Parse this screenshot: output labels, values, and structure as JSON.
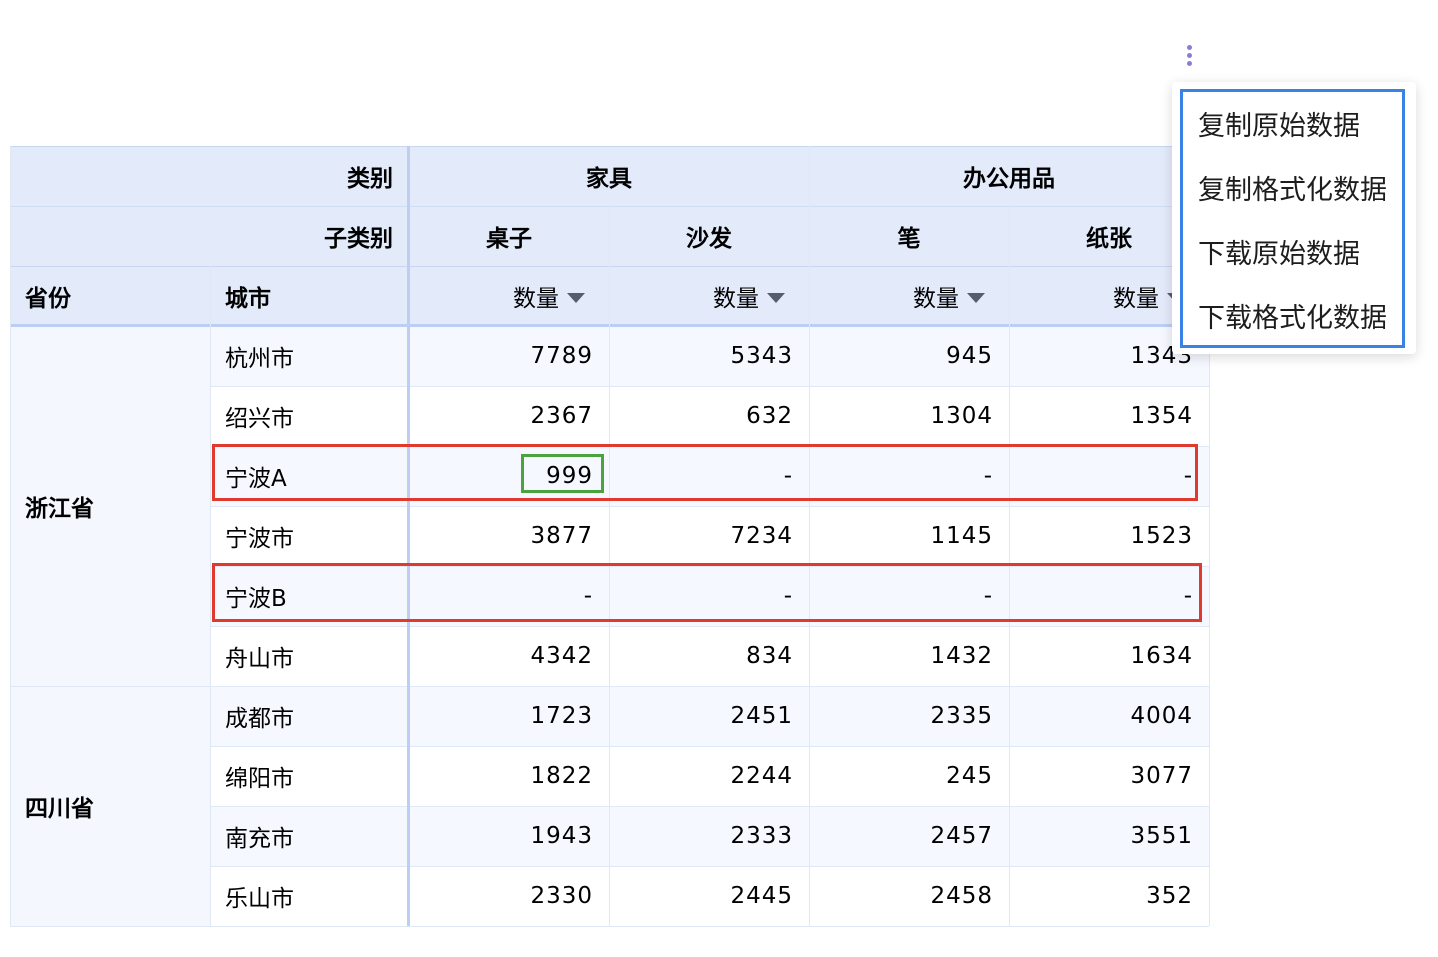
{
  "table": {
    "corner": {
      "category_label": "类别",
      "subcategory_label": "子类别"
    },
    "row_headers": [
      "省份",
      "城市"
    ],
    "categories": [
      {
        "label": "家具",
        "subcategories": [
          "桌子",
          "沙发"
        ]
      },
      {
        "label": "办公用品",
        "subcategories": [
          "笔",
          "纸张"
        ]
      }
    ],
    "measure_label": "数量",
    "provinces": [
      {
        "name": "浙江省",
        "cities": [
          {
            "city": "杭州市",
            "values": [
              "7789",
              "5343",
              "945",
              "1343"
            ]
          },
          {
            "city": "绍兴市",
            "values": [
              "2367",
              "632",
              "1304",
              "1354"
            ]
          },
          {
            "city": "宁波A",
            "values": [
              "999",
              "-",
              "-",
              "-"
            ]
          },
          {
            "city": "宁波市",
            "values": [
              "3877",
              "7234",
              "1145",
              "1523"
            ]
          },
          {
            "city": "宁波B",
            "values": [
              "-",
              "-",
              "-",
              "-"
            ]
          },
          {
            "city": "舟山市",
            "values": [
              "4342",
              "834",
              "1432",
              "1634"
            ]
          }
        ]
      },
      {
        "name": "四川省",
        "cities": [
          {
            "city": "成都市",
            "values": [
              "1723",
              "2451",
              "2335",
              "4004"
            ]
          },
          {
            "city": "绵阳市",
            "values": [
              "1822",
              "2244",
              "245",
              "3077"
            ]
          },
          {
            "city": "南充市",
            "values": [
              "1943",
              "2333",
              "2457",
              "3551"
            ]
          },
          {
            "city": "乐山市",
            "values": [
              "2330",
              "2445",
              "2458",
              "352"
            ]
          }
        ]
      }
    ]
  },
  "context_menu": {
    "items": [
      "复制原始数据",
      "复制格式化数据",
      "下载原始数据",
      "下载格式化数据"
    ]
  },
  "colors": {
    "header_bg": "#e3ebfb",
    "row_highlight": "#e0392e",
    "cell_highlight": "#4aa33c",
    "menu_border": "#3b82e6",
    "more_dots": "#8a7cd8"
  },
  "icons": {
    "more": "more-vertical-icon",
    "sort": "sort-desc-icon"
  }
}
